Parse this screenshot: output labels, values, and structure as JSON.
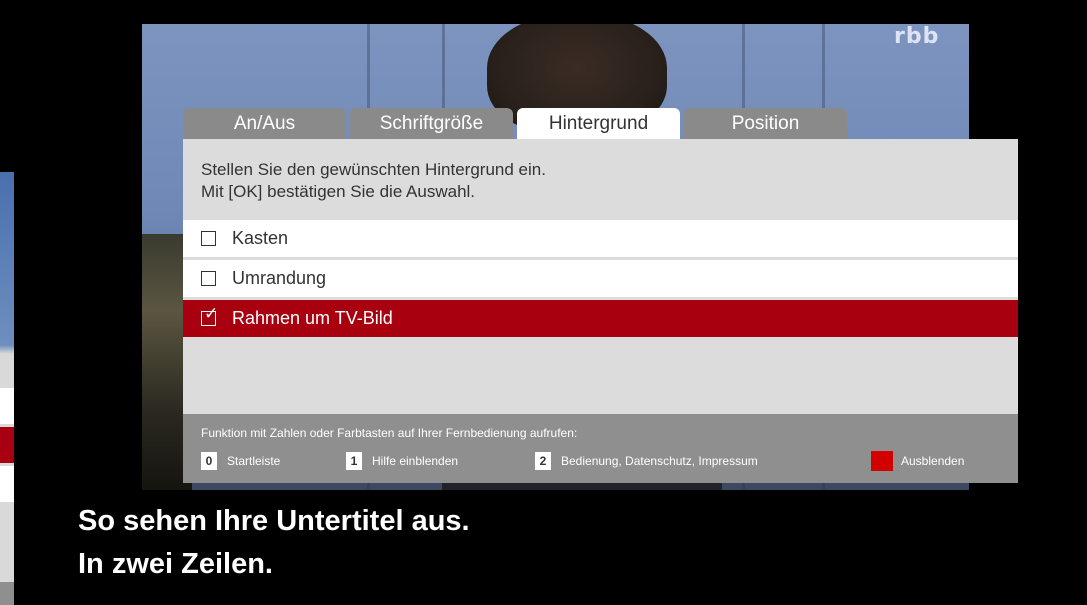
{
  "channel_logo": "rbb",
  "tabs": [
    {
      "label": "An/Aus",
      "active": false
    },
    {
      "label": "Schriftgröße",
      "active": false
    },
    {
      "label": "Hintergrund",
      "active": true
    },
    {
      "label": "Position",
      "active": false
    }
  ],
  "instructions": {
    "line1": "Stellen Sie den gewünschten Hintergrund ein.",
    "line2": "Mit [OK] bestätigen Sie die Auswahl."
  },
  "options": [
    {
      "label": "Kasten",
      "checked": false,
      "selected": false
    },
    {
      "label": "Umrandung",
      "checked": false,
      "selected": false
    },
    {
      "label": "Rahmen um TV-Bild",
      "checked": true,
      "selected": true
    }
  ],
  "footer": {
    "hint": "Funktion mit Zahlen oder Farbtasten auf Ihrer Fernbedienung aufrufen:",
    "keys": [
      {
        "key": "0",
        "label": "Startleiste"
      },
      {
        "key": "1",
        "label": "Hilfe einblenden"
      },
      {
        "key": "2",
        "label": "Bedienung, Datenschutz, Impressum"
      }
    ],
    "red_key_label": "Ausblenden",
    "red_key_color": "#d20000"
  },
  "subtitle_preview": {
    "line1": "So sehen Ihre Untertitel aus.",
    "line2": "In zwei Zeilen."
  },
  "colors": {
    "accent_red": "#a8000f",
    "tab_inactive": "#8a8a8a",
    "panel_bg": "#dcdcdc"
  }
}
